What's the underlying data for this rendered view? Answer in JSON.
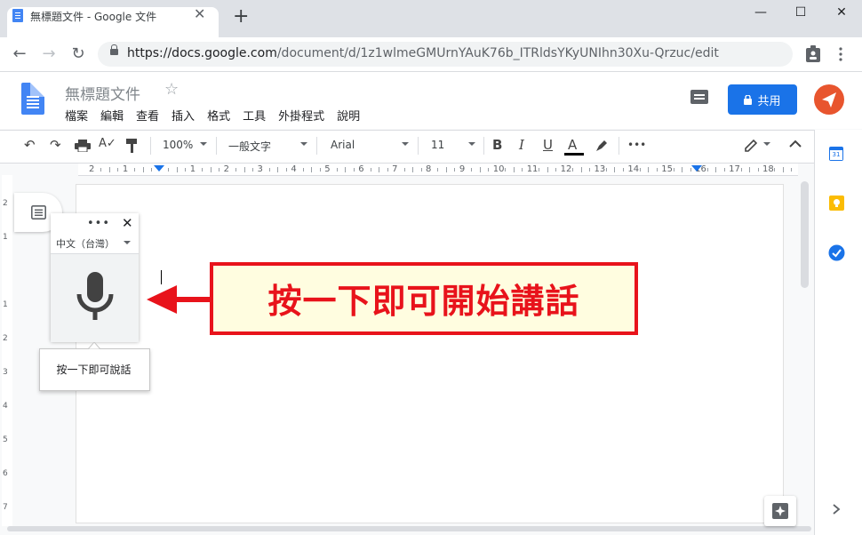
{
  "browser": {
    "tab_title": "無標題文件 - Google 文件",
    "tab_close": "✕",
    "new_tab": "+",
    "url_host": "https://docs.google.com",
    "url_path": "/document/d/1z1wlmeGMUrnYAuK76b_ITRldsYKyUNIhn30Xu-Qrzuc/edit",
    "window_controls": {
      "minimize": "—",
      "maximize": "☐",
      "close": "✕"
    }
  },
  "docs": {
    "title": "無標題文件",
    "star": "☆",
    "menu": [
      "檔案",
      "編輯",
      "查看",
      "插入",
      "格式",
      "工具",
      "外掛程式",
      "說明"
    ],
    "share_label": "共用",
    "colors": {
      "accent": "#1a73e8",
      "avatar": "#e8552e"
    }
  },
  "format_toolbar": {
    "zoom": "100%",
    "style": "一般文字",
    "font": "Arial",
    "size": "11",
    "bold": "B",
    "italic": "I",
    "underline": "U",
    "text_color": "A",
    "more": "•••"
  },
  "ruler": {
    "labels": [
      "2",
      "1",
      "",
      "1",
      "2",
      "3",
      "4",
      "5",
      "6",
      "7",
      "8",
      "9",
      "10",
      "11",
      "12",
      "13",
      "14",
      "15",
      "16",
      "17",
      "18"
    ]
  },
  "vertical_ruler": {
    "labels": [
      "2",
      "1",
      "",
      "1",
      "2",
      "3",
      "4",
      "5",
      "6",
      "7"
    ]
  },
  "voice_typing": {
    "menu_dots": "•••",
    "close": "✕",
    "language": "中文（台灣）",
    "tooltip": "按一下即可說話"
  },
  "callout": {
    "text": "按一下即可開始講話",
    "color": "#e8131b"
  },
  "side_panel": {
    "calendar_day": "31"
  }
}
